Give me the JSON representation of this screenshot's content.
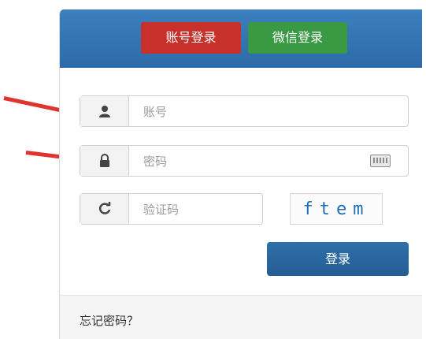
{
  "tabs": {
    "account_login": "账号登录",
    "wechat_login": "微信登录"
  },
  "fields": {
    "account_placeholder": "账号",
    "password_placeholder": "密码",
    "captcha_placeholder": "验证码"
  },
  "captcha": {
    "text": "ftem"
  },
  "buttons": {
    "login": "登录"
  },
  "footer": {
    "forgot_password": "忘记密码？"
  },
  "icons": {
    "account": "user-icon",
    "password": "lock-icon",
    "captcha_refresh": "refresh-icon",
    "keyboard": "keyboard-icon"
  },
  "colors": {
    "header_blue": "#2d6aa8",
    "account_tab_red": "#c8302b",
    "wechat_tab_green": "#3a9a43",
    "login_blue": "#255d93",
    "arrow_red": "#e0342e"
  }
}
